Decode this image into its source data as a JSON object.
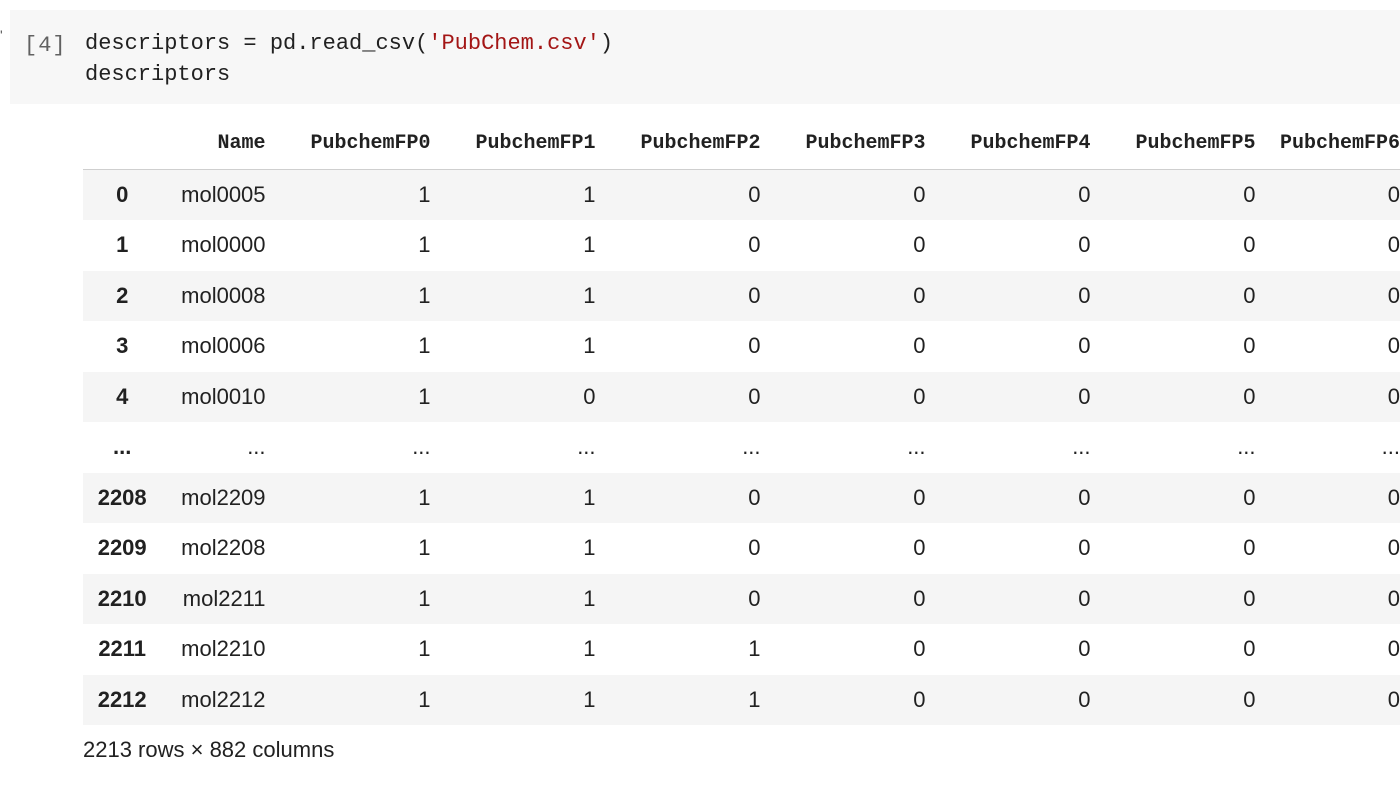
{
  "cell": {
    "execution_count": "[4]",
    "code_line1_pre": "descriptors = pd.read_csv(",
    "code_line1_str": "'PubChem.csv'",
    "code_line1_post": ")",
    "code_line2": "descriptors"
  },
  "dataframe": {
    "columns": [
      "",
      "Name",
      "PubchemFP0",
      "PubchemFP1",
      "PubchemFP2",
      "PubchemFP3",
      "PubchemFP4",
      "PubchemFP5",
      "PubchemFP6"
    ],
    "rows": [
      {
        "index": "0",
        "values": [
          "mol0005",
          "1",
          "1",
          "0",
          "0",
          "0",
          "0",
          "0"
        ]
      },
      {
        "index": "1",
        "values": [
          "mol0000",
          "1",
          "1",
          "0",
          "0",
          "0",
          "0",
          "0"
        ]
      },
      {
        "index": "2",
        "values": [
          "mol0008",
          "1",
          "1",
          "0",
          "0",
          "0",
          "0",
          "0"
        ]
      },
      {
        "index": "3",
        "values": [
          "mol0006",
          "1",
          "1",
          "0",
          "0",
          "0",
          "0",
          "0"
        ]
      },
      {
        "index": "4",
        "values": [
          "mol0010",
          "1",
          "0",
          "0",
          "0",
          "0",
          "0",
          "0"
        ]
      },
      {
        "index": "...",
        "values": [
          "...",
          "...",
          "...",
          "...",
          "...",
          "...",
          "...",
          "..."
        ]
      },
      {
        "index": "2208",
        "values": [
          "mol2209",
          "1",
          "1",
          "0",
          "0",
          "0",
          "0",
          "0"
        ]
      },
      {
        "index": "2209",
        "values": [
          "mol2208",
          "1",
          "1",
          "0",
          "0",
          "0",
          "0",
          "0"
        ]
      },
      {
        "index": "2210",
        "values": [
          "mol2211",
          "1",
          "1",
          "0",
          "0",
          "0",
          "0",
          "0"
        ]
      },
      {
        "index": "2211",
        "values": [
          "mol2210",
          "1",
          "1",
          "1",
          "0",
          "0",
          "0",
          "0"
        ]
      },
      {
        "index": "2212",
        "values": [
          "mol2212",
          "1",
          "1",
          "1",
          "0",
          "0",
          "0",
          "0"
        ]
      }
    ],
    "shape_text": "2213 rows × 882 columns"
  }
}
